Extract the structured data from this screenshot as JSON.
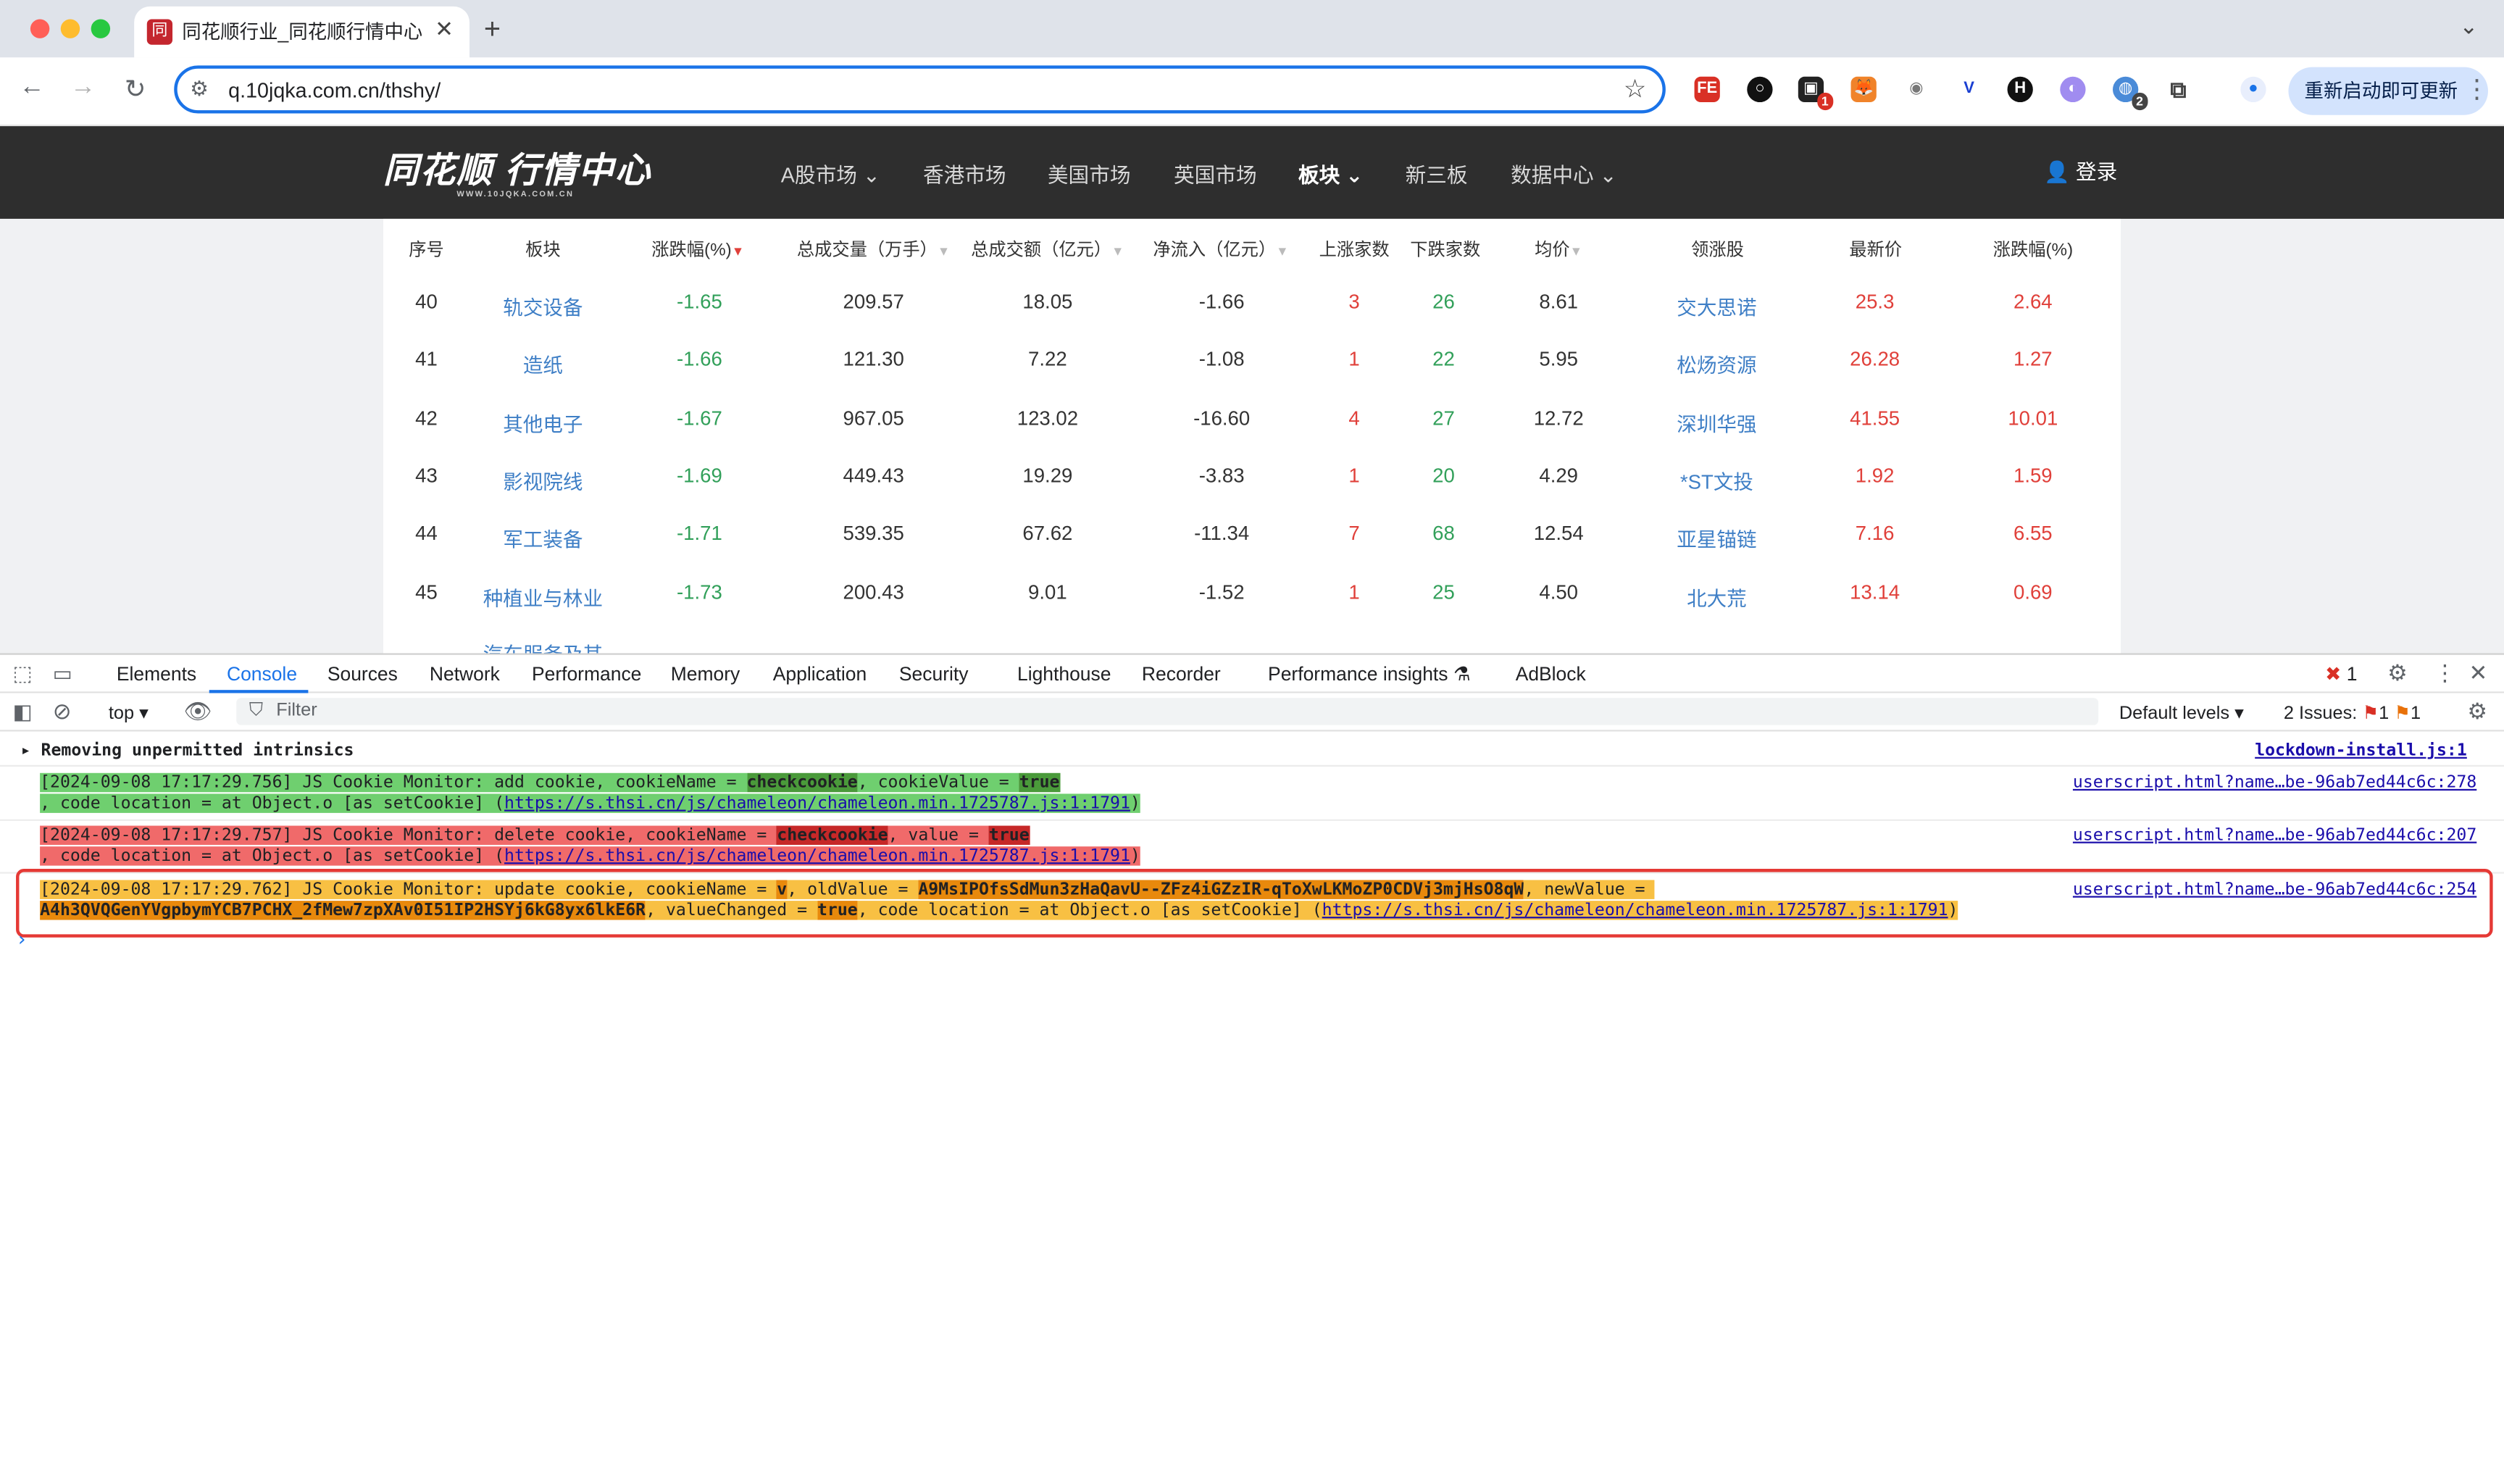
{
  "browser": {
    "tab_title": "同花顺行业_同花顺行情中心_同",
    "url": "q.10jqka.com.cn/thshy/",
    "update_button": "重新启动即可更新",
    "ext_badge_1": "1",
    "ext_badge_2": "2",
    "favicon_text": "同"
  },
  "site": {
    "logo_text": "同花顺 行情中心",
    "logo_sub": "WWW.10JQKA.COM.CN",
    "nav": [
      "A股市场",
      "香港市场",
      "美国市场",
      "英国市场",
      "板块",
      "新三板",
      "数据中心"
    ],
    "login": "登录"
  },
  "table": {
    "headers": [
      "序号",
      "板块",
      "涨跌幅(%)",
      "总成交量（万手）",
      "总成交额（亿元）",
      "净流入（亿元）",
      "上涨家数",
      "下跌家数",
      "均价",
      "领涨股",
      "最新价",
      "涨跌幅(%)"
    ],
    "rows": [
      [
        "40",
        "轨交设备",
        "-1.65",
        "209.57",
        "18.05",
        "-1.66",
        "3",
        "26",
        "8.61",
        "交大思诺",
        "25.3",
        "2.64"
      ],
      [
        "41",
        "造纸",
        "-1.66",
        "121.30",
        "7.22",
        "-1.08",
        "1",
        "22",
        "5.95",
        "松炀资源",
        "26.28",
        "1.27"
      ],
      [
        "42",
        "其他电子",
        "-1.67",
        "967.05",
        "123.02",
        "-16.60",
        "4",
        "27",
        "12.72",
        "深圳华强",
        "41.55",
        "10.01"
      ],
      [
        "43",
        "影视院线",
        "-1.69",
        "449.43",
        "19.29",
        "-3.83",
        "1",
        "20",
        "4.29",
        "*ST文投",
        "1.92",
        "1.59"
      ],
      [
        "44",
        "军工装备",
        "-1.71",
        "539.35",
        "67.62",
        "-11.34",
        "7",
        "68",
        "12.54",
        "亚星锚链",
        "7.16",
        "6.55"
      ],
      [
        "45",
        "种植业与林业",
        "-1.73",
        "200.43",
        "9.01",
        "-1.52",
        "1",
        "25",
        "4.50",
        "北大荒",
        "13.14",
        "0.69"
      ]
    ],
    "partial_row_label": "汽车服务及其"
  },
  "devtools": {
    "tabs": [
      "Elements",
      "Console",
      "Sources",
      "Network",
      "Performance",
      "Memory",
      "Application",
      "Security",
      "Lighthouse",
      "Recorder",
      "Performance insights",
      "AdBlock"
    ],
    "error_count": "1",
    "context": "top",
    "filter_placeholder": "Filter",
    "levels": "Default levels",
    "issues_label": "2 Issues:",
    "issues_red": "1",
    "issues_orange": "1"
  },
  "console": {
    "group_message": "Removing unpermitted intrinsics",
    "group_source": "lockdown-install.js:1",
    "entries": [
      {
        "line1_pre": "[2024-09-08 17:17:29.756] JS Cookie Monitor: add cookie, cookieName = ",
        "k1": "checkcookie",
        "line1_mid": ", cookieValue = ",
        "k2": "true",
        "line2_pre": ", code location = at Object.o [as setCookie] (",
        "link": "https://s.thsi.cn/js/chameleon/chameleon.min.1725787.js:1:1791",
        "line2_post": ")",
        "source": "userscript.html?name…be-96ab7ed44c6c:278",
        "bg": "#6fcf6f"
      },
      {
        "line1_pre": "[2024-09-08 17:17:29.757] JS Cookie Monitor: delete cookie, cookieName = ",
        "k1": "checkcookie",
        "line1_mid": ", value = ",
        "k2": "true",
        "line2_pre": ", code location = at Object.o [as setCookie] (",
        "link": "https://s.thsi.cn/js/chameleon/chameleon.min.1725787.js:1:1791",
        "line2_post": ")",
        "source": "userscript.html?name…be-96ab7ed44c6c:207",
        "bg": "#f06a6a"
      },
      {
        "line1_pre": "[2024-09-08 17:17:29.762] JS Cookie Monitor: update cookie, cookieName = ",
        "k1": "v",
        "line1_mid": ", oldValue = ",
        "k2": "A9MsIPOfsSdMun3zHaQavU--ZFz4iGZzIR-qToXwLKMoZP0CDVj3mjHsO8qW",
        "line1_post": ", newValue = ",
        "line2_k": "A4h3QVQGenYVgpbymYCB7PCHX_2fMew7zpXAv0I51IP2HSYj6kG8yx6lkE6R",
        "line2_mid": ", valueChanged = ",
        "line2_k2": "true",
        "line2_pre": ", code location = at Object.o [as setCookie] (",
        "link": "https://s.thsi.cn/js/chameleon/chameleon.min.1725787.js:1:1791",
        "line2_post": ")",
        "source": "userscript.html?name…be-96ab7ed44c6c:254",
        "bg": "#f8c043"
      }
    ],
    "prompt": "›"
  },
  "colors": {
    "rise": "#e0403a",
    "fall": "#32a05a",
    "link": "#3f7fc6",
    "accent": "#1a73e8"
  }
}
